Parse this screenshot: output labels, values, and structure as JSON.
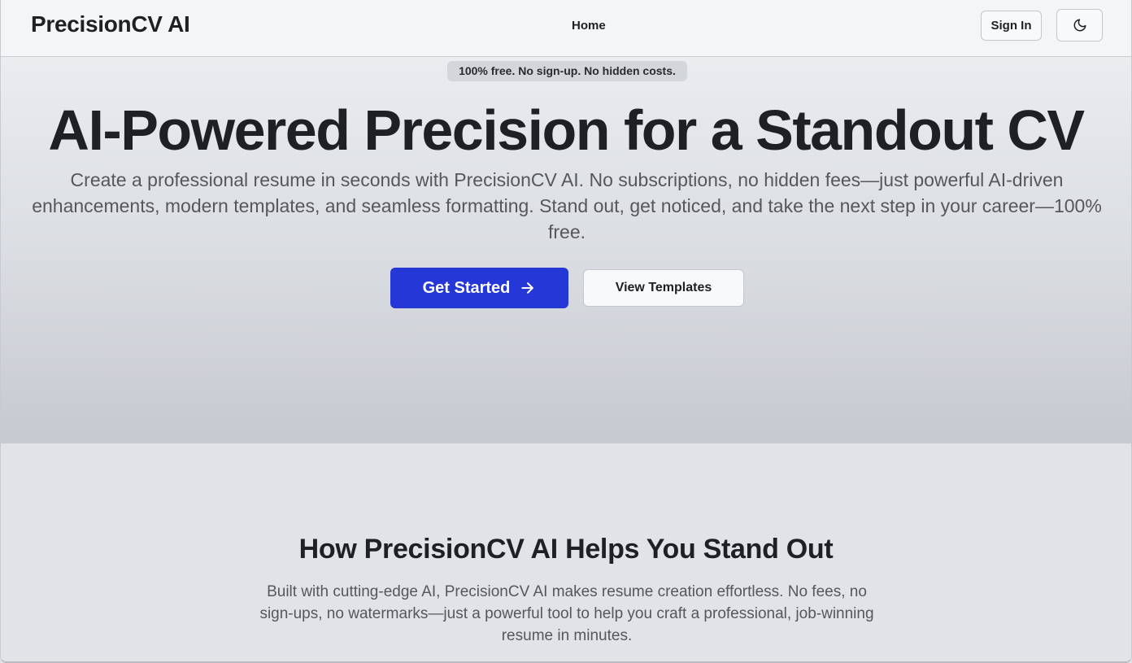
{
  "header": {
    "brand": "PrecisionCV AI",
    "nav": {
      "home": "Home"
    },
    "sign_in_label": "Sign In",
    "theme_toggle_icon": "moon-icon"
  },
  "hero": {
    "badge": "100% free. No sign-up. No hidden costs.",
    "title": "AI-Powered Precision for a Standout CV",
    "subtitle": "Create a professional resume in seconds with PrecisionCV AI. No subscriptions, no hidden fees—just powerful AI-driven enhancements, modern templates, and seamless formatting. Stand out, get noticed, and take the next step in your career—100% free.",
    "primary_cta": {
      "label": "Get Started",
      "icon": "arrow-right-icon"
    },
    "secondary_cta": {
      "label": "View Templates"
    }
  },
  "features": {
    "title": "How PrecisionCV AI Helps You Stand Out",
    "description": "Built with cutting-edge AI, PrecisionCV AI makes resume creation effortless. No fees, no sign-ups, no watermarks—just a powerful tool to help you craft a professional, job-winning resume in minutes."
  },
  "colors": {
    "primary": "#2537d6",
    "text": "#1f2024",
    "muted_text": "#55575d"
  }
}
